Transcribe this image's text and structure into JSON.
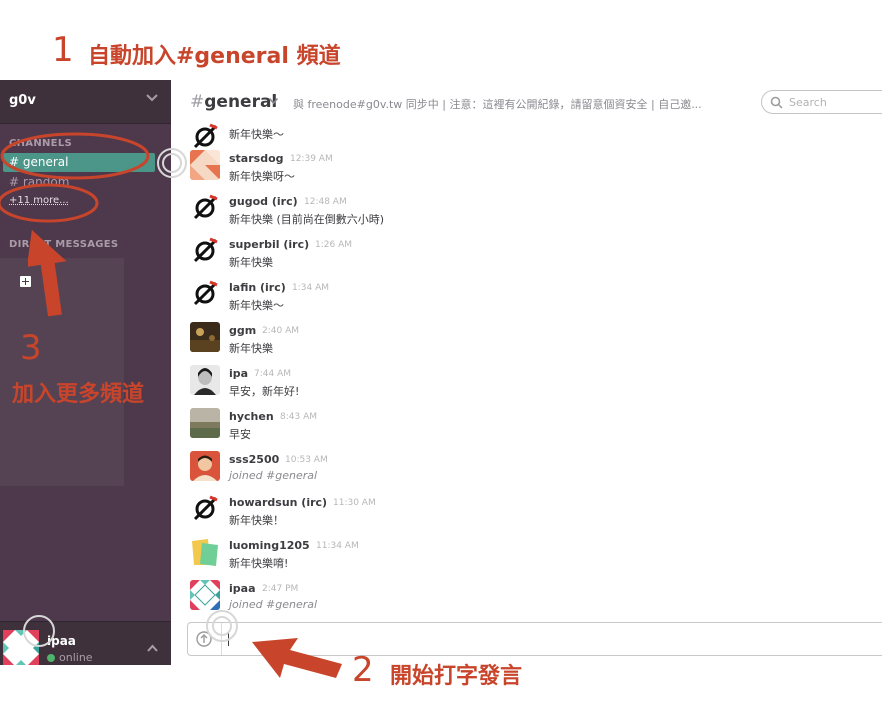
{
  "annotations": {
    "step1": {
      "num": "1",
      "text": "自動加入#general 頻道"
    },
    "step2": {
      "num": "2",
      "text": "開始打字發言"
    },
    "step3": {
      "num": "3",
      "text": "加入更多頻道"
    },
    "color": "#c8452b"
  },
  "sidebar": {
    "team_name": "g0v",
    "channels_title": "CHANNELS",
    "channels": [
      {
        "label": "# general",
        "active": true
      },
      {
        "label": "# random",
        "active": false
      }
    ],
    "more_label": "+11 more...",
    "dm_title": "DIRECT MESSAGES",
    "user": {
      "name": "ipaa",
      "status": "online"
    },
    "colors": {
      "background": "#4d394b",
      "active_channel": "#4c9689"
    }
  },
  "header": {
    "channel_hash": "#",
    "channel_name": "general",
    "topic": "與 freenode#g0v.tw 同步中 | 注意：這裡有公開紀錄，請留意個資安全 | 自己邀...",
    "search_placeholder": "Search"
  },
  "messages": [
    {
      "author": "",
      "time": "",
      "text": "新年快樂～",
      "avatar": "no-symbol-icon"
    },
    {
      "author": "starsdog",
      "time": "12:39 AM",
      "text": "新年快樂呀～",
      "avatar": "quilt-avatar"
    },
    {
      "author": "gugod (irc)",
      "time": "12:48 AM",
      "text": "新年快樂 (目前尚在倒數六小時)",
      "avatar": "no-symbol-icon"
    },
    {
      "author": "superbil (irc)",
      "time": "1:26 AM",
      "text": "新年快樂",
      "avatar": "no-symbol-icon"
    },
    {
      "author": "lafin (irc)",
      "time": "1:34 AM",
      "text": "新年快樂～",
      "avatar": "no-symbol-icon"
    },
    {
      "author": "ggm",
      "time": "2:40 AM",
      "text": "新年快樂",
      "avatar": "photo-avatar-dark"
    },
    {
      "author": "ipa",
      "time": "7:44 AM",
      "text": "早安，新年好!",
      "avatar": "photo-avatar-portrait"
    },
    {
      "author": "hychen",
      "time": "8:43 AM",
      "text": "早安",
      "avatar": "photo-avatar-landscape"
    },
    {
      "author": "sss2500",
      "time": "10:53 AM",
      "text": "joined #general",
      "system": true,
      "avatar": "photo-avatar-red"
    },
    {
      "author": "howardsun (irc)",
      "time": "11:30 AM",
      "text": "新年快樂！",
      "avatar": "no-symbol-icon"
    },
    {
      "author": "luoming1205",
      "time": "11:34 AM",
      "text": "新年快樂唷!",
      "avatar": "folder-avatar"
    },
    {
      "author": "ipaa",
      "time": "2:47 PM",
      "text": "joined #general",
      "system": true,
      "avatar": "quilt-avatar-blue"
    }
  ],
  "composer": {
    "value": "",
    "placeholder": ""
  }
}
